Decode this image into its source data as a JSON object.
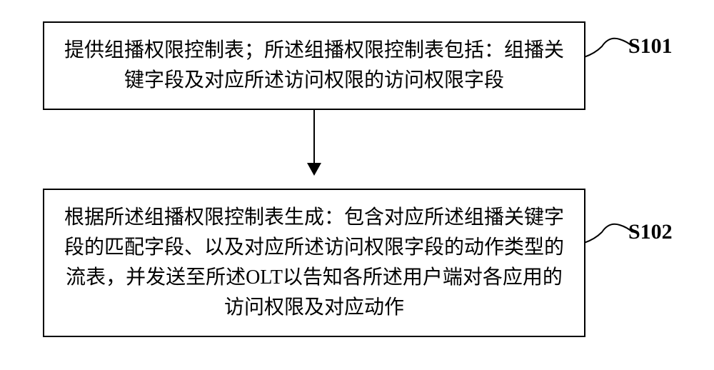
{
  "flowchart": {
    "steps": [
      {
        "id": "S101",
        "text": "提供组播权限控制表；所述组播权限控制表包括：组播关键字段及对应所述访问权限的访问权限字段"
      },
      {
        "id": "S102",
        "text": "根据所述组播权限控制表生成：包含对应所述组播关键字段的匹配字段、以及对应所述访问权限字段的动作类型的流表，并发送至所述OLT以告知各所述用户端对各应用的访问权限及对应动作"
      }
    ]
  }
}
